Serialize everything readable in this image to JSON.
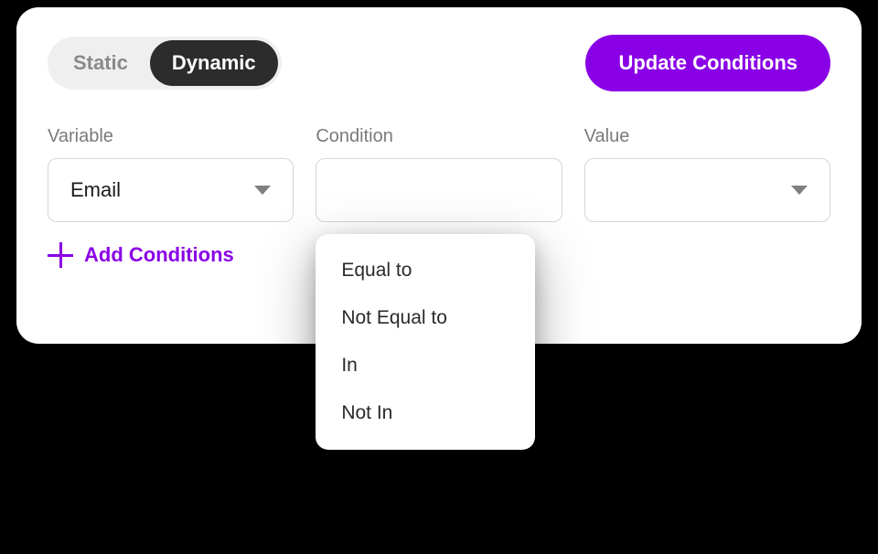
{
  "toggle": {
    "static_label": "Static",
    "dynamic_label": "Dynamic",
    "active": "dynamic"
  },
  "actions": {
    "update_label": "Update Conditions",
    "add_label": "Add Conditions"
  },
  "fields": {
    "variable": {
      "label": "Variable",
      "value": "Email"
    },
    "condition": {
      "label": "Condition",
      "value": "",
      "options": [
        "Equal to",
        "Not Equal to",
        "In",
        "Not In"
      ]
    },
    "value": {
      "label": "Value",
      "value": ""
    }
  }
}
